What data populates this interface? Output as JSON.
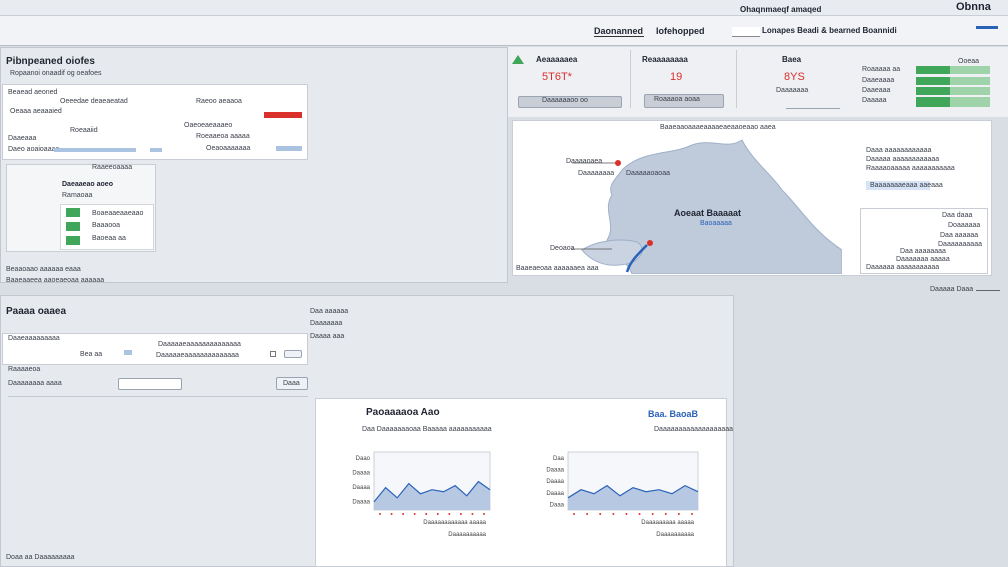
{
  "topbar": {
    "title": "Ohaqnmaeqf amaqed",
    "brand": "Obnna"
  },
  "header_nav": {
    "item1": "Daonanned",
    "item2": "Iofehopped",
    "search_placeholder": "",
    "menu": "Lonapes Beadi & bearned Boannidi"
  },
  "left_panel": {
    "title": "Pibnpeaned oiofes",
    "subtitle": "Ropaanoi onaadif og oeafoes",
    "rows": [
      {
        "label": "Beaead aeoned",
        "value": "Oeeedae deaeaeatad"
      },
      {
        "label": "Raeoo aeaaoa",
        "value": "Oeaaa aeaaaied"
      },
      {
        "label": "Roeaaiid",
        "value": "Oaeoeaeaaaeo"
      },
      {
        "label": "Daaeaaa",
        "value": ""
      }
    ],
    "filter_card": {
      "row1": "Roeaaeoa aaaaa",
      "row2": "Daeo aoaioaaaa",
      "row3": "Oeaoaaaaaaa",
      "row4": "Oaaoaaeoaa"
    },
    "sub_card": {
      "title": "Raaeeoaaaa",
      "heading": "Daeaaeao aoeo",
      "sub": "Ramaoaa",
      "items": [
        "Boaeaaeaaeaao",
        "Baaaooa",
        "Baoeaa aa"
      ]
    },
    "footer1": "Beaaoaao aaaaaa eaaa",
    "footer2": "Baaeaaeea aaoeaeoaa aaaaaa"
  },
  "stats": [
    {
      "label": "Aeaaaaaea",
      "value": "5T6T*",
      "caption": "Daaaaaaoo oo"
    },
    {
      "label": "Reaaaaaaaa",
      "value": "19",
      "caption": "Roaaaoa aoaa"
    },
    {
      "label": "Baea",
      "value": "8YS",
      "caption": "Daaaaaaa"
    }
  ],
  "right_legend": {
    "title": "Ooeaa",
    "rows": [
      "Roaaaaa aa",
      "Daaeaaaa",
      "Daaeaaa",
      "Daaaaa"
    ]
  },
  "map": {
    "header": "Baaeaaoaaaeaaaaeaeaaoeaao aaea",
    "label": "Aoeaat Baaaaat",
    "sublabel": "Baoaaaaa",
    "callouts": [
      "Daaaaoaea",
      "Daaaaaaaa",
      "Daaaaaoaoaa",
      "Deoaoa"
    ],
    "footer": "Baaeaeoaa aaaaaaea aaa",
    "side_top": [
      "Daaa aaaaaaaaaaaa",
      "Daaaaa aaaaaaaaaaaa",
      "Raaaaoaaaaa aaaaaaaaaaa",
      "Baaaaaaaeaaa aaeaaa"
    ],
    "side_rows": [
      "Daa daaa",
      "Doaaaaaa",
      "Daa aaaaaa",
      "Daaaaaaaaaa",
      "Daa aaaaaaaa",
      "Daaaaaaa aaaaa",
      "Daaaaaa aaaaaaaaaaa"
    ],
    "scale": "Daaaaa Daaa"
  },
  "lower_panel": {
    "title": "Paaaa oaaea",
    "rows": [
      {
        "label": "Daaeaaaaaaaaa",
        "value": "Bea aa",
        "extra": "Daaaaaeaaaaaaaaaaaaaa"
      },
      {
        "label": "Raaaaeoa",
        "value": "",
        "extra": ""
      }
    ],
    "sub_title": "Daaaaaaaa aaaa",
    "button": "Daaa",
    "side": [
      "Daa aaaaaa",
      "Daaaaaaa",
      "Daaaa aaa"
    ],
    "footer": "Doaa aa Daaaaaaaaa"
  },
  "report": {
    "title": "Paoaaaaoa Aao",
    "subtitle": "Daa Daaaaaaaoaa Baaaaa aaaaaaaaaaa",
    "tag": "Baa. BaoaB",
    "right_sub": "Daaaaaaaaaaaaaaaaaaa",
    "left_chart": {
      "y_labels": [
        "Daao",
        "Daaaa",
        "Daaaa",
        "Daaaa"
      ],
      "x_labels": [
        "Daaaaaaaaaaaa aaaaa",
        "Daaaaaaaaaa"
      ],
      "values": [
        0.2,
        0.55,
        0.3,
        0.65,
        0.4,
        0.5,
        0.45,
        0.6,
        0.35,
        0.7,
        0.5
      ]
    },
    "right_chart": {
      "y_labels": [
        "Daa",
        "Daaaa",
        "Daaaa",
        "Daaaa",
        "Daaa"
      ],
      "x_labels": [
        "Daaaaaaaaa aaaaa",
        "Daaaaaaaaaa"
      ],
      "values": [
        0.3,
        0.5,
        0.4,
        0.6,
        0.35,
        0.55,
        0.45,
        0.5,
        0.4,
        0.6,
        0.45
      ]
    }
  },
  "colors": {
    "accent": "#2a62b8",
    "positive": "#3fa65a",
    "alert": "#d9302c"
  }
}
